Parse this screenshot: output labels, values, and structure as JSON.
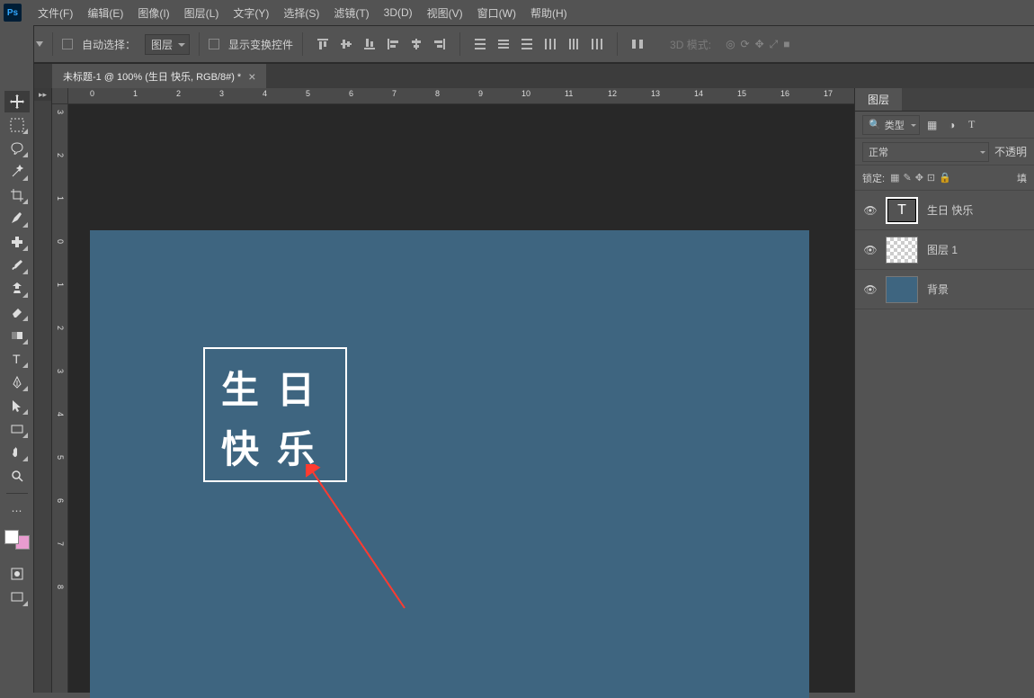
{
  "app": {
    "logo": "Ps"
  },
  "menu": [
    "文件(F)",
    "编辑(E)",
    "图像(I)",
    "图层(L)",
    "文字(Y)",
    "选择(S)",
    "滤镜(T)",
    "3D(D)",
    "视图(V)",
    "窗口(W)",
    "帮助(H)"
  ],
  "options": {
    "auto_select_label": "自动选择：",
    "auto_select_value": "图层",
    "show_transform_label": "显示变换控件",
    "mode3d_label": "3D 模式:"
  },
  "tab": {
    "title": "未标题-1 @ 100% (生日 快乐, RGB/8#) *",
    "close": "×"
  },
  "ruler_h": [
    0,
    1,
    2,
    3,
    4,
    5,
    6,
    7,
    8,
    9,
    10,
    11,
    12,
    13,
    14,
    15,
    16,
    17
  ],
  "ruler_v": [
    3,
    2,
    1,
    0,
    1,
    2,
    3,
    4,
    5,
    6,
    7,
    8
  ],
  "canvas_text": {
    "line1": "生日",
    "line2": "快乐"
  },
  "layers_panel": {
    "tab": "图层",
    "filter_label": "类型",
    "blend_mode": "正常",
    "opacity_label": "不透明",
    "lock_label": "锁定:",
    "fill_label": "填",
    "items": [
      {
        "name": "生日 快乐",
        "type": "text",
        "selected": true
      },
      {
        "name": "图层 1",
        "type": "raster",
        "selected": false
      },
      {
        "name": "背景",
        "type": "bg",
        "selected": false
      }
    ]
  },
  "colors": {
    "fg": "#ffffff",
    "bg": "#e89ccf"
  },
  "canvas_bg": "#3e6580"
}
